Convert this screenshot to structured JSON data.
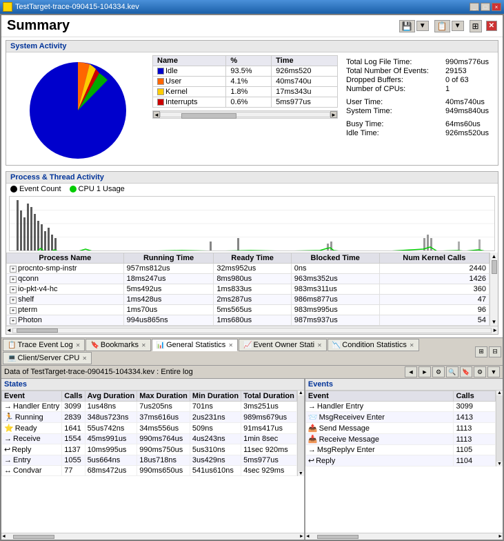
{
  "titlebar": {
    "title": "TestTarget-trace-090415-104334.kev",
    "close_label": "×",
    "minimize_label": "_",
    "maximize_label": "□"
  },
  "summary": {
    "title": "Summary",
    "toolbar_buttons": [
      "save",
      "export",
      "resize",
      "close"
    ]
  },
  "system_activity": {
    "section_title": "System Activity",
    "table_headers": [
      "Name",
      "%",
      "Time"
    ],
    "table_rows": [
      {
        "color": "#0000cc",
        "name": "Idle",
        "pct": "93.5%",
        "time": "926ms520"
      },
      {
        "color": "#ff6600",
        "name": "User",
        "pct": "4.1%",
        "time": "40ms740u"
      },
      {
        "color": "#ffcc00",
        "name": "Kernel",
        "pct": "1.8%",
        "time": "17ms343u"
      },
      {
        "color": "#cc0000",
        "name": "Interrupts",
        "pct": "0.6%",
        "time": "5ms977us"
      }
    ],
    "stats": {
      "total_log_file_time_label": "Total Log File Time:",
      "total_log_file_time_value": "990ms776us",
      "total_events_label": "Total Number Of Events:",
      "total_events_value": "29153",
      "dropped_buffers_label": "Dropped Buffers:",
      "dropped_buffers_value": "0 of 63",
      "num_cpus_label": "Number of CPUs:",
      "num_cpus_value": "1",
      "user_time_label": "User Time:",
      "user_time_value": "40ms740us",
      "system_time_label": "System Time:",
      "system_time_value": "949ms840us",
      "busy_time_label": "Busy Time:",
      "busy_time_value": "64ms60us",
      "idle_time_label": "Idle Time:",
      "idle_time_value": "926ms520us"
    }
  },
  "process_thread": {
    "section_title": "Process & Thread Activity",
    "legend": {
      "event_count": "Event Count",
      "cpu_usage": "CPU 1 Usage"
    },
    "table_headers": [
      "Process Name",
      "Running Time",
      "Ready Time",
      "Blocked Time",
      "Num Kernel Calls"
    ],
    "table_rows": [
      {
        "name": "procnto-smp-instr",
        "running": "957ms812us",
        "ready": "32ms952us",
        "blocked": "0ns",
        "kernel_calls": "2440"
      },
      {
        "name": "qconn",
        "running": "18ms247us",
        "ready": "8ms980us",
        "blocked": "963ms352us",
        "kernel_calls": "1426"
      },
      {
        "name": "io-pkt-v4-hc",
        "running": "5ms492us",
        "ready": "1ms833us",
        "blocked": "983ms311us",
        "kernel_calls": "360"
      },
      {
        "name": "shelf",
        "running": "1ms428us",
        "ready": "2ms287us",
        "blocked": "986ms877us",
        "kernel_calls": "47"
      },
      {
        "name": "pterm",
        "running": "1ms70us",
        "ready": "5ms565us",
        "blocked": "983ms995us",
        "kernel_calls": "96"
      },
      {
        "name": "Photon",
        "running": "994us865ns",
        "ready": "1ms680us",
        "blocked": "987ms937us",
        "kernel_calls": "54"
      }
    ]
  },
  "tabs": [
    {
      "label": "Trace Event Log",
      "icon": "📋",
      "active": false
    },
    {
      "label": "Bookmarks",
      "icon": "🔖",
      "active": false
    },
    {
      "label": "General Statistics",
      "icon": "📊",
      "active": true
    },
    {
      "label": "Event Owner Stati",
      "icon": "📈",
      "active": false
    },
    {
      "label": "Condition Statistics",
      "icon": "📉",
      "active": false
    },
    {
      "label": "Client/Server CPU",
      "icon": "💻",
      "active": false
    }
  ],
  "bottom_toolbar": {
    "data_label": "Data of TestTarget-trace-090415-104334.kev : Entire log"
  },
  "states_panel": {
    "title": "States",
    "headers": [
      "Event",
      "Calls",
      "Avg Duration",
      "Max Duration",
      "Min Duration",
      "Total Duration"
    ],
    "rows": [
      {
        "icon": "→",
        "event": "Handler Entry",
        "calls": "3099",
        "avg": "1us48ns",
        "max": "7us205ns",
        "min": "701ns",
        "total": "3ms251us"
      },
      {
        "icon": "🏃",
        "event": "Running",
        "calls": "2839",
        "avg": "348us723ns",
        "max": "37ms616us",
        "min": "2us231ns",
        "total": "989ms679us"
      },
      {
        "icon": "⭐",
        "event": "Ready",
        "calls": "1641",
        "avg": "55us742ns",
        "max": "34ms556us",
        "min": "509ns",
        "total": "91ms417us"
      },
      {
        "icon": "→",
        "event": "Receive",
        "calls": "1554",
        "avg": "45ms991us",
        "max": "990ms764us",
        "min": "4us243ns",
        "total": "1min 8sec"
      },
      {
        "icon": "↩",
        "event": "Reply",
        "calls": "1137",
        "avg": "10ms995us",
        "max": "990ms750us",
        "min": "5us310ns",
        "total": "11sec 920ms"
      },
      {
        "icon": "→",
        "event": "Entry",
        "calls": "1055",
        "avg": "5us664ns",
        "max": "18us718ns",
        "min": "3us429ns",
        "total": "5ms977us"
      },
      {
        "icon": "↔",
        "event": "Condvar",
        "calls": "77",
        "avg": "68ms472us",
        "max": "990ms650us",
        "min": "541us610ns",
        "total": "4sec 929ms"
      }
    ]
  },
  "events_panel": {
    "title": "Events",
    "headers": [
      "Event",
      "Calls"
    ],
    "rows": [
      {
        "icon": "→",
        "event": "Handler Entry",
        "calls": "3099"
      },
      {
        "icon": "📨",
        "event": "MsgReceivev Enter",
        "calls": "1413"
      },
      {
        "icon": "📤",
        "event": "Send Message",
        "calls": "1113"
      },
      {
        "icon": "📥",
        "event": "Receive Message",
        "calls": "1113"
      },
      {
        "icon": "→",
        "event": "MsgReplyv Enter",
        "calls": "1105"
      },
      {
        "icon": "↩",
        "event": "Reply",
        "calls": "1104"
      }
    ]
  }
}
